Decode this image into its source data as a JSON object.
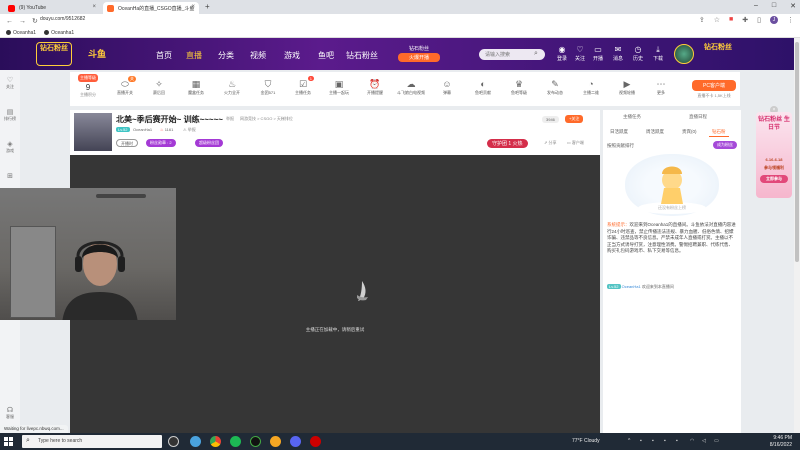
{
  "browser": {
    "tabs": [
      {
        "label": "(9) YouTube"
      },
      {
        "label": "OceanHa的直播_CSGO直播_斗鱼"
      }
    ],
    "url": "douyu.com/9512682",
    "bookmarks": [
      "Oceanha1",
      "Oceanha1"
    ],
    "status_text": "Waiting for livepc.nbwq.com..."
  },
  "header": {
    "logo_text": "钻石粉丝",
    "logo_text2": "斗鱼",
    "nav": [
      "首页",
      "直播",
      "分类",
      "视频",
      "游戏",
      "鱼吧",
      "钻石粉丝"
    ],
    "promo_title": "钻石粉丝",
    "promo_button": "火爆开播",
    "search_placeholder": "请输入搜索",
    "icons": [
      "登录",
      "关注",
      "开播",
      "消息",
      "历史",
      "下载"
    ],
    "badge_text": "钻石粉丝"
  },
  "sidebar": {
    "items": [
      "关注",
      "排行榜",
      "游戏",
      "设置",
      "客服"
    ]
  },
  "toolbar": {
    "online_tag": "主播等级",
    "online_count": "9",
    "online_label": "主播积分",
    "tools": [
      "直播开关",
      "赛后回",
      "魔盒任务",
      "火力全开",
      "金团571",
      "主播任务",
      "主播一起玩",
      "开播提醒",
      "斗飞娘白电视频",
      "弹幕",
      "鱼吧贡献",
      "鱼吧等级",
      "发布动态",
      "主播二维",
      "视频轮播",
      "更多"
    ],
    "tool_badges": [
      "关",
      "1",
      "2"
    ],
    "pc_client_label": "PC客户端",
    "pc_client_sub": "直播不卡 1,5K上线"
  },
  "room": {
    "title": "北美~季后赛开始~ 训练~~~~~",
    "report": "举报",
    "category": "网游竞技 > CSGO > 天梯排位",
    "level": "Lv.52",
    "anchor_name": "OceanHa1",
    "heat": "1161",
    "report2": "举报",
    "pill1": "开播时",
    "pill2": "粉丝勋章 : 2",
    "pill3": "超级粉丝团",
    "view_count": "3946",
    "follow_label": "+关注",
    "fan_club": "守护团 1 火热",
    "share": "分享",
    "client": "客户端"
  },
  "video": {
    "message": "主播正在加载中，请稍后重试"
  },
  "right_panel": {
    "top_left": "主播任务",
    "top_right": "直播日程",
    "tabs": [
      "日活跃度",
      "周活跃度",
      "贵宾(0)",
      "钻石粉"
    ],
    "rank_title": "按照贡献排行",
    "rank_button": "成为粉丝",
    "empty_text": "还没有粉丝上榜",
    "system_tag": "系统提示：",
    "system_message": "欢迎来到Oceanha1的直播间。斗鱼依法对直播内容进行24小时巡查，禁止传播违法违规、暴力血腥、低俗色情、招嫖诈骗、违禁品等不良信息。严禁未成年人直播或打赏。主播以不正当方式诱导打赏，注意理性消费。警惕招聘兼职、代练代售、购买礼包码游戏币、私下交易等信息。",
    "chat_level": "Lv.52",
    "chat_name": "OceanHa1",
    "chat_text": "欢迎来到本直播间"
  },
  "ad": {
    "title": "钻石粉丝 生日节",
    "date": "6.16-6.18",
    "sub": "参与领福利",
    "button": "立即参与"
  },
  "taskbar": {
    "search_placeholder": "Type here to search",
    "weather": "77°F  Cloudy",
    "time": "9:46 PM",
    "date": "8/16/2022"
  },
  "colors": {
    "accent": "#ff6a2a",
    "header_bg": "#4a1680",
    "purple_pill": "#a43ad5",
    "video_bg": "#363636"
  }
}
